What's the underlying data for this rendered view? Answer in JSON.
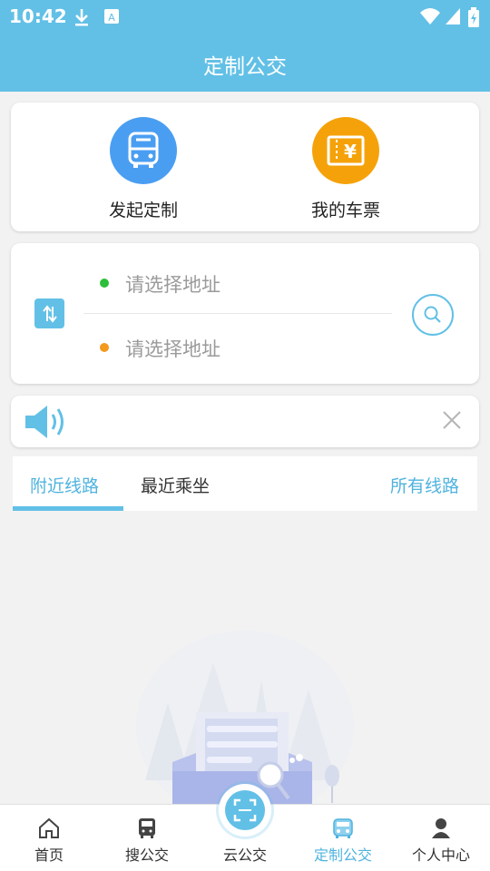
{
  "status": {
    "time": "10:42"
  },
  "header": {
    "title": "定制公交"
  },
  "quick_actions": [
    {
      "label": "发起定制",
      "icon": "bus-icon",
      "color": "#4a9ef2"
    },
    {
      "label": "我的车票",
      "icon": "ticket-icon",
      "color": "#f5a20a"
    }
  ],
  "route": {
    "from_placeholder": "请选择地址",
    "to_placeholder": "请选择地址",
    "from_dot_color": "#2dbf3a",
    "to_dot_color": "#f39a1c"
  },
  "tabs": {
    "nearby": "附近线路",
    "recent": "最近乘坐",
    "all": "所有线路"
  },
  "bottom_nav": [
    {
      "label": "首页",
      "icon": "home-icon"
    },
    {
      "label": "搜公交",
      "icon": "bus-icon"
    },
    {
      "label": "云公交",
      "icon": "scan-icon"
    },
    {
      "label": "定制公交",
      "icon": "custom-bus-icon",
      "active": true
    },
    {
      "label": "个人中心",
      "icon": "person-icon"
    }
  ],
  "colors": {
    "accent": "#62c0e6",
    "active_text": "#4fb3df"
  }
}
